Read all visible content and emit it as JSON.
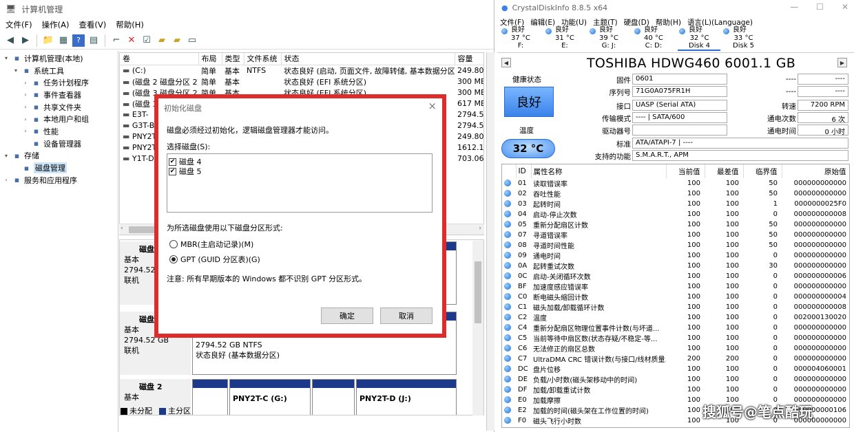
{
  "left": {
    "title": "计算机管理",
    "menu": [
      "文件(F)",
      "操作(A)",
      "查看(V)",
      "帮助(H)"
    ],
    "tree": [
      {
        "label": "计算机管理(本地)",
        "indent": 0,
        "expander": "▾",
        "icon": "computer-icon"
      },
      {
        "label": "系统工具",
        "indent": 1,
        "expander": "▾",
        "icon": "tools-icon"
      },
      {
        "label": "任务计划程序",
        "indent": 2,
        "expander": "›",
        "icon": "clock-icon"
      },
      {
        "label": "事件查看器",
        "indent": 2,
        "expander": "›",
        "icon": "event-viewer-icon"
      },
      {
        "label": "共享文件夹",
        "indent": 2,
        "expander": "›",
        "icon": "shared-folder-icon"
      },
      {
        "label": "本地用户和组",
        "indent": 2,
        "expander": "›",
        "icon": "users-icon"
      },
      {
        "label": "性能",
        "indent": 2,
        "expander": "›",
        "icon": "performance-icon"
      },
      {
        "label": "设备管理器",
        "indent": 2,
        "expander": "",
        "icon": "device-manager-icon"
      },
      {
        "label": "存储",
        "indent": 0,
        "expander": "▾",
        "icon": "storage-icon"
      },
      {
        "label": "磁盘管理",
        "indent": 1,
        "expander": "",
        "icon": "disk-management-icon",
        "selected": true
      },
      {
        "label": "服务和应用程序",
        "indent": 0,
        "expander": "›",
        "icon": "services-icon"
      }
    ],
    "volumes": {
      "headers": [
        "卷",
        "布局",
        "类型",
        "文件系统",
        "状态",
        "容量"
      ],
      "rows": [
        [
          "(C:)",
          "简单",
          "基本",
          "NTFS",
          "状态良好 (启动, 页面文件, 故障转储, 基本数据分区)",
          "249.80"
        ],
        [
          "(磁盘 2 磁盘分区 2)",
          "简单",
          "基本",
          "",
          "状态良好 (EFI 系统分区)",
          "300 MB"
        ],
        [
          "(磁盘 3 磁盘分区 2)",
          "简单",
          "基本",
          "",
          "状态良好 (EFI 系统分区)",
          "300 MB"
        ],
        [
          "(磁盘 3",
          "",
          "",
          "",
          "",
          "617 MB"
        ],
        [
          "E3T-",
          "",
          "",
          "",
          "",
          "2794.52"
        ],
        [
          "G3T-B",
          "",
          "",
          "",
          "",
          "2794.52"
        ],
        [
          "PNY2T",
          "",
          "",
          "",
          "",
          "249.80"
        ],
        [
          "PNY2T",
          "",
          "",
          "",
          "",
          "1612.19"
        ],
        [
          "Y1T-D",
          "",
          "",
          "",
          "",
          "703.06"
        ]
      ]
    },
    "disks": [
      {
        "name": "磁盘",
        "type": "基本",
        "size": "2794.52",
        "status": "联机"
      },
      {
        "name": "磁盘",
        "type": "基本",
        "size": "2794.52 GB",
        "status": "联机",
        "part_size": "2794.52 GB NTFS",
        "part_status": "状态良好 (基本数据分区)"
      },
      {
        "name": "磁盘 2",
        "type": "基本",
        "part_g": "PNY2T-C  (G:)",
        "part_j": "PNY2T-D  (J:)"
      }
    ],
    "legend": {
      "unallocated": "未分配",
      "primary": "主分区"
    },
    "colors": {
      "primary": "#1d3a8a",
      "unallocated": "#000000",
      "dialog_border": "#e02b2b"
    }
  },
  "dialog": {
    "title": "初始化磁盘",
    "message": "磁盘必须经过初始化，逻辑磁盘管理器才能访问。",
    "select_label": "选择磁盘(S):",
    "disks": [
      {
        "label": "磁盘 4",
        "checked": true
      },
      {
        "label": "磁盘 5",
        "checked": true
      }
    ],
    "partition_label": "为所选磁盘使用以下磁盘分区形式:",
    "mbr": "MBR(主启动记录)(M)",
    "gpt": "GPT (GUID 分区表)(G)",
    "selected": "gpt",
    "note": "注意: 所有早期版本的 Windows 都不识别 GPT 分区形式。",
    "ok": "确定",
    "cancel": "取消"
  },
  "right": {
    "title": "CrystalDiskInfo 8.8.5 x64",
    "menu": [
      "文件(F)",
      "编辑(E)",
      "功能(U)",
      "主题(T)",
      "硬盘(D)",
      "帮助(H)",
      "语言(L)(Language)"
    ],
    "disk_status": [
      {
        "h": "良好",
        "t": "37 °C",
        "d": "F:"
      },
      {
        "h": "良好",
        "t": "31 °C",
        "d": "E:"
      },
      {
        "h": "良好",
        "t": "39 °C",
        "d": "G: J:"
      },
      {
        "h": "良好",
        "t": "40 °C",
        "d": "C: D:"
      },
      {
        "h": "良好",
        "t": "32 °C",
        "d": "Disk 4",
        "active": true
      },
      {
        "h": "良好",
        "t": "33 °C",
        "d": "Disk 5"
      }
    ],
    "model": "TOSHIBA HDWG460 6001.1 GB",
    "health_label": "健康状态",
    "health": "良好",
    "temp_label": "温度",
    "temp": "32 °C",
    "fields": {
      "firmware_label": "固件",
      "firmware": "0601",
      "serial_label": "序列号",
      "serial": "71G0A075FR1H",
      "interface_label": "接口",
      "interface": "UASP (Serial ATA)",
      "transfer_label": "传输模式",
      "transfer": "---- | SATA/600",
      "drive_label": "驱动器号",
      "drive": "",
      "standard_label": "标准",
      "standard": "ATA/ATAPI-7 | ----",
      "features_label": "支持的功能",
      "features": "S.M.A.R.T., APM",
      "blank1_label": "----",
      "blank1": "----",
      "blank2_label": "----",
      "blank2": "----",
      "rpm_label": "转速",
      "rpm": "7200 RPM",
      "power_count_label": "通电次数",
      "power_count": "6 次",
      "power_hours_label": "通电时间",
      "power_hours": "0 小时"
    },
    "smart_headers": [
      "ID",
      "属性名称",
      "当前值",
      "最差值",
      "临界值",
      "原始值"
    ],
    "smart": [
      [
        "01",
        "读取错误率",
        "100",
        "100",
        "50",
        "000000000000"
      ],
      [
        "02",
        "吞吐性能",
        "100",
        "100",
        "50",
        "000000000000"
      ],
      [
        "03",
        "起转时间",
        "100",
        "100",
        "1",
        "0000000025F0"
      ],
      [
        "04",
        "启动-停止次数",
        "100",
        "100",
        "0",
        "000000000008"
      ],
      [
        "05",
        "重新分配扇区计数",
        "100",
        "100",
        "50",
        "000000000000"
      ],
      [
        "07",
        "寻道错误率",
        "100",
        "100",
        "50",
        "000000000000"
      ],
      [
        "08",
        "寻道时间性能",
        "100",
        "100",
        "50",
        "000000000000"
      ],
      [
        "09",
        "通电时间",
        "100",
        "100",
        "0",
        "000000000000"
      ],
      [
        "0A",
        "起转重试次数",
        "100",
        "100",
        "30",
        "000000000000"
      ],
      [
        "0C",
        "启动-关闭循环次数",
        "100",
        "100",
        "0",
        "000000000006"
      ],
      [
        "BF",
        "加速度感应错误率",
        "100",
        "100",
        "0",
        "000000000000"
      ],
      [
        "C0",
        "断电磁头缩回计数",
        "100",
        "100",
        "0",
        "000000000004"
      ],
      [
        "C1",
        "磁头加载/卸载循环计数",
        "100",
        "100",
        "0",
        "000000000008"
      ],
      [
        "C2",
        "温度",
        "100",
        "100",
        "0",
        "002000130020"
      ],
      [
        "C4",
        "重新分配扇区物理位置事件计数(与坏道...",
        "100",
        "100",
        "0",
        "000000000000"
      ],
      [
        "C5",
        "当前等待中扇区数(状态存疑/不稳定-等...",
        "100",
        "100",
        "0",
        "000000000000"
      ],
      [
        "C6",
        "无法修正的扇区总数",
        "100",
        "100",
        "0",
        "000000000000"
      ],
      [
        "C7",
        "UltraDMA CRC 错误计数(与接口/线材质量...",
        "200",
        "200",
        "0",
        "000000000000"
      ],
      [
        "DC",
        "盘片位移",
        "100",
        "100",
        "0",
        "000004060001"
      ],
      [
        "DE",
        "负载/小时数(磁头架移动中的时间)",
        "100",
        "100",
        "0",
        "000000000000"
      ],
      [
        "DF",
        "加载/卸载重试计数",
        "100",
        "100",
        "0",
        "000000000000"
      ],
      [
        "E0",
        "加载摩擦",
        "100",
        "100",
        "0",
        "000000000000"
      ],
      [
        "E2",
        "加载的时间(磁头架在工作位置的时间)",
        "100",
        "100",
        "0",
        "000000000106"
      ],
      [
        "F0",
        "磁头飞行小时数",
        "100",
        "100",
        "0",
        "000000000000"
      ]
    ],
    "watermark": "搜狐号@笔点酷玩"
  }
}
